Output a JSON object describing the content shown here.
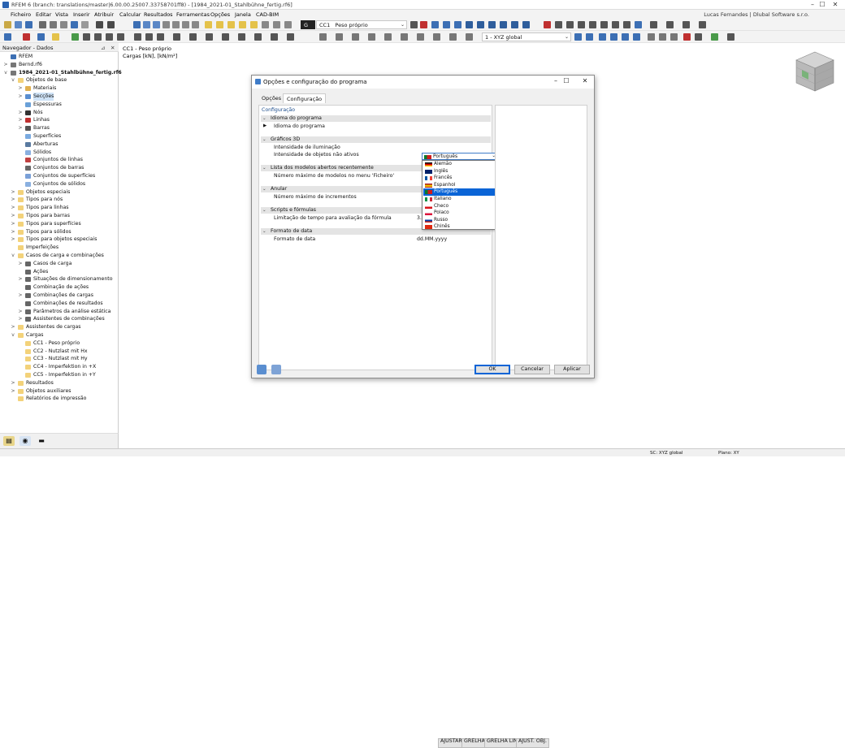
{
  "window": {
    "title": "RFEM 6 (branch: translations/master|6.00.00.25007.33758701ff8) - [1984_2021-01_Stahlbühne_fertig.rf6]",
    "minimize": "–",
    "maximize": "☐",
    "close": "✕"
  },
  "menu": {
    "items": [
      "Ficheiro",
      "Editar",
      "Vista",
      "Inserir",
      "Atribuir",
      "Calcular",
      "Resultados",
      "Ferramentas",
      "Opções",
      "Janela",
      "CAD-BIM"
    ],
    "user": "Lucas Fernandes | Dlubal Software s.r.o."
  },
  "toolbar": {
    "lc_badge": "G",
    "lc_id": "CC1",
    "lc_name": "Peso próprio",
    "coord_system": "1 - XYZ global"
  },
  "navigator": {
    "title": "Navegador - Dados",
    "items": [
      {
        "label": "RFEM",
        "level": 0,
        "exp": "",
        "icon": "#3c6fb4"
      },
      {
        "label": "Bernd.rf6",
        "level": 0,
        "exp": ">",
        "icon": "#777"
      },
      {
        "label": "1984_2021-01_Stahlbühne_fertig.rf6",
        "level": 0,
        "exp": "v",
        "icon": "#777",
        "bold": true
      },
      {
        "label": "Objetos de base",
        "level": 1,
        "exp": "v",
        "icon": "#f3d27a"
      },
      {
        "label": "Materiais",
        "level": 2,
        "exp": ">",
        "icon": "#e0b050"
      },
      {
        "label": "Secções",
        "level": 2,
        "exp": ">",
        "icon": "#5a8ed0",
        "selected": true
      },
      {
        "label": "Espessuras",
        "level": 2,
        "exp": "",
        "icon": "#6aa0d8"
      },
      {
        "label": "Nós",
        "level": 2,
        "exp": ">",
        "icon": "#333"
      },
      {
        "label": "Linhas",
        "level": 2,
        "exp": ">",
        "icon": "#c03030"
      },
      {
        "label": "Barras",
        "level": 2,
        "exp": ">",
        "icon": "#555"
      },
      {
        "label": "Superfícies",
        "level": 2,
        "exp": "",
        "icon": "#7aaae0"
      },
      {
        "label": "Aberturas",
        "level": 2,
        "exp": "",
        "icon": "#5a7aa0"
      },
      {
        "label": "Sólidos",
        "level": 2,
        "exp": "",
        "icon": "#8ab0e0"
      },
      {
        "label": "Conjuntos de linhas",
        "level": 2,
        "exp": "",
        "icon": "#c04040"
      },
      {
        "label": "Conjuntos de barras",
        "level": 2,
        "exp": "",
        "icon": "#666"
      },
      {
        "label": "Conjuntos de superfícies",
        "level": 2,
        "exp": "",
        "icon": "#7aa0d8"
      },
      {
        "label": "Conjuntos de sólidos",
        "level": 2,
        "exp": "",
        "icon": "#8ab0e0"
      },
      {
        "label": "Objetos especiais",
        "level": 1,
        "exp": ">",
        "icon": "#f3d27a"
      },
      {
        "label": "Tipos para nós",
        "level": 1,
        "exp": ">",
        "icon": "#f3d27a"
      },
      {
        "label": "Tipos para linhas",
        "level": 1,
        "exp": ">",
        "icon": "#f3d27a"
      },
      {
        "label": "Tipos para barras",
        "level": 1,
        "exp": ">",
        "icon": "#f3d27a"
      },
      {
        "label": "Tipos para superfícies",
        "level": 1,
        "exp": ">",
        "icon": "#f3d27a"
      },
      {
        "label": "Tipos para sólidos",
        "level": 1,
        "exp": ">",
        "icon": "#f3d27a"
      },
      {
        "label": "Tipos para objetos especiais",
        "level": 1,
        "exp": ">",
        "icon": "#f3d27a"
      },
      {
        "label": "Imperfeições",
        "level": 1,
        "exp": "",
        "icon": "#f3d27a"
      },
      {
        "label": "Casos de carga e combinações",
        "level": 1,
        "exp": "v",
        "icon": "#f3d27a"
      },
      {
        "label": "Casos de carga",
        "level": 2,
        "exp": ">",
        "icon": "#666"
      },
      {
        "label": "Ações",
        "level": 2,
        "exp": "",
        "icon": "#666"
      },
      {
        "label": "Situações de dimensionamento",
        "level": 2,
        "exp": ">",
        "icon": "#666"
      },
      {
        "label": "Combinação de ações",
        "level": 2,
        "exp": "",
        "icon": "#666"
      },
      {
        "label": "Combinações de cargas",
        "level": 2,
        "exp": ">",
        "icon": "#666"
      },
      {
        "label": "Combinações de resultados",
        "level": 2,
        "exp": "",
        "icon": "#666"
      },
      {
        "label": "Parâmetros da análise estática",
        "level": 2,
        "exp": ">",
        "icon": "#666"
      },
      {
        "label": "Assistentes de combinações",
        "level": 2,
        "exp": ">",
        "icon": "#666"
      },
      {
        "label": "Assistentes de cargas",
        "level": 1,
        "exp": ">",
        "icon": "#f3d27a"
      },
      {
        "label": "Cargas",
        "level": 1,
        "exp": "v",
        "icon": "#f3d27a"
      },
      {
        "label": "CC1 - Peso próprio",
        "level": 2,
        "exp": "",
        "icon": "#f3d27a"
      },
      {
        "label": "CC2 - Nutzlast mit Hx",
        "level": 2,
        "exp": "",
        "icon": "#f3d27a"
      },
      {
        "label": "CC3 - Nutzlast mit Hy",
        "level": 2,
        "exp": "",
        "icon": "#f3d27a"
      },
      {
        "label": "CC4 - Imperfektion in +X",
        "level": 2,
        "exp": "",
        "icon": "#f3d27a"
      },
      {
        "label": "CC5 - Imperfektion in +Y",
        "level": 2,
        "exp": "",
        "icon": "#f3d27a"
      },
      {
        "label": "Resultados",
        "level": 1,
        "exp": ">",
        "icon": "#f3d27a"
      },
      {
        "label": "Objetos auxiliares",
        "level": 1,
        "exp": ">",
        "icon": "#f3d27a"
      },
      {
        "label": "Relatórios de impressão",
        "level": 1,
        "exp": "",
        "icon": "#f3d27a"
      }
    ]
  },
  "viewport": {
    "line1": "CC1 - Peso próprio",
    "line2": "Cargas [kN], [kN/m²]"
  },
  "dialog": {
    "title": "Opções e configuração do programa",
    "tabs": [
      "Opções",
      "Configuração"
    ],
    "section_label": "Configuração",
    "sections": [
      {
        "title": "Idioma do programa",
        "rows": [
          {
            "label": "Idioma do programa",
            "value": ""
          }
        ]
      },
      {
        "title": "Gráficos 3D",
        "rows": [
          {
            "label": "Intensidade de iluminação",
            "value": ""
          },
          {
            "label": "Intensidade de objetos não ativos",
            "value": ""
          }
        ]
      },
      {
        "title": "Lista dos modelos abertos recentemente",
        "rows": [
          {
            "label": "Número máximo de modelos no menu 'Ficheiro'",
            "value": ""
          }
        ]
      },
      {
        "title": "Anular",
        "rows": [
          {
            "label": "Número máximo de incrementos",
            "value": ""
          }
        ]
      },
      {
        "title": "Scripts e fórmulas",
        "rows": [
          {
            "label": "Limitação de tempo para avaliação da fórmula",
            "value": "3.000 s"
          }
        ]
      },
      {
        "title": "Formato de data",
        "rows": [
          {
            "label": "Formato de data",
            "value": "dd.MM.yyyy"
          }
        ]
      }
    ],
    "language_selected": "Português",
    "languages": [
      "Alemão",
      "Inglês",
      "Francês",
      "Espanhol",
      "Português",
      "Italiano",
      "Checo",
      "Polaco",
      "Russo",
      "Chinês"
    ],
    "buttons": {
      "ok": "OK",
      "cancel": "Cancelar",
      "apply": "Aplicar"
    }
  },
  "statusbar": {
    "buttons": [
      "AJUSTAR",
      "GRELHA",
      "GRELHA LIN.",
      "AJUST. OBJ."
    ],
    "cs": "SC: XYZ global",
    "plane": "Plano: XY"
  }
}
